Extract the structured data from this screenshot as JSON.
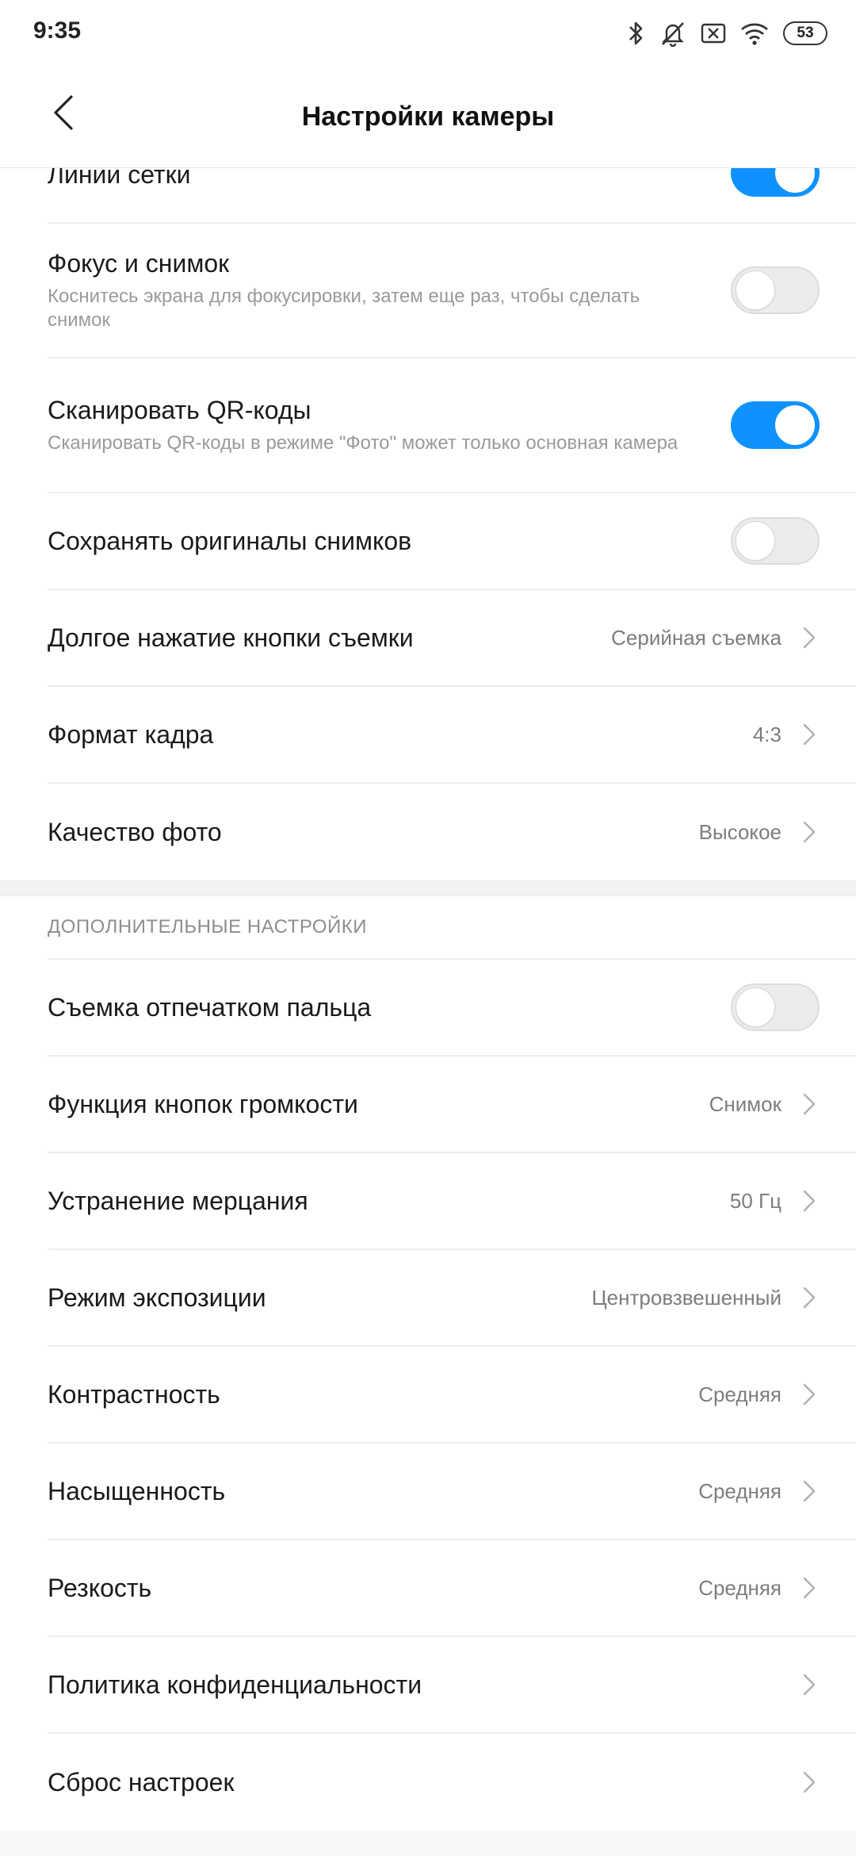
{
  "status": {
    "time": "9:35",
    "battery": "53",
    "icons": [
      "bluetooth-icon",
      "bell-off-icon",
      "no-sim-icon",
      "wifi-icon",
      "battery-icon"
    ]
  },
  "header": {
    "title": "Настройки камеры",
    "back_icon": "chevron-left-icon"
  },
  "colors": {
    "accent": "#0f92ff",
    "toggle_off": "#ececec",
    "secondary_text": "#7d7d7d"
  },
  "main": {
    "items": [
      {
        "label": "Линии сетки",
        "type": "toggle",
        "on": true
      },
      {
        "label": "Фокус и снимок",
        "desc": "Коснитесь экрана для фокусировки, затем еще раз, чтобы сделать снимок",
        "type": "toggle",
        "on": false
      },
      {
        "label": "Сканировать QR-коды",
        "desc": "Сканировать QR-коды в режиме \"Фото\" может только основная камера",
        "type": "toggle",
        "on": true
      },
      {
        "label": "Сохранять оригиналы снимков",
        "type": "toggle",
        "on": false
      },
      {
        "label": "Долгое нажатие кнопки съемки",
        "value": "Серийная съемка",
        "type": "link"
      },
      {
        "label": "Формат кадра",
        "value": "4:3",
        "type": "link"
      },
      {
        "label": "Качество фото",
        "value": "Высокое",
        "type": "link"
      }
    ]
  },
  "advanced": {
    "header": "ДОПОЛНИТЕЛЬНЫЕ НАСТРОЙКИ",
    "items": [
      {
        "label": "Съемка отпечатком пальца",
        "type": "toggle",
        "on": false
      },
      {
        "label": "Функция кнопок громкости",
        "value": "Снимок",
        "type": "link"
      },
      {
        "label": "Устранение мерцания",
        "value": "50 Гц",
        "type": "link"
      },
      {
        "label": "Режим экспозиции",
        "value": "Центровзвешенный",
        "type": "link"
      },
      {
        "label": "Контрастность",
        "value": "Средняя",
        "type": "link"
      },
      {
        "label": "Насыщенность",
        "value": "Средняя",
        "type": "link"
      },
      {
        "label": "Резкость",
        "value": "Средняя",
        "type": "link"
      },
      {
        "label": "Политика конфиденциальности",
        "value": "",
        "type": "link"
      },
      {
        "label": "Сброс настроек",
        "value": "",
        "type": "link"
      }
    ]
  }
}
